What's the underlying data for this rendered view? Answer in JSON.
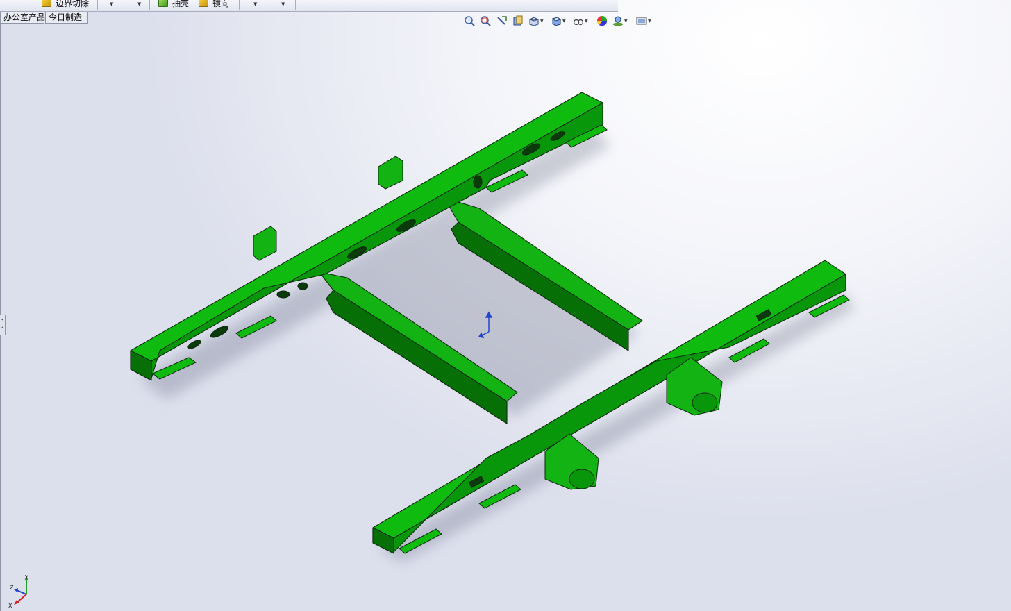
{
  "toolbar": {
    "buttons": [
      {
        "id": "boundary-cut",
        "label": "边界切除",
        "icon": "boundary-cut-icon"
      },
      {
        "id": "shell",
        "label": "抽壳",
        "icon": "shell-icon"
      },
      {
        "id": "mirror",
        "label": "镜向",
        "icon": "mirror-icon"
      }
    ]
  },
  "tabs": [
    {
      "label": "办公室产品"
    },
    {
      "label": "今日制造"
    }
  ],
  "heads_up_toolbar": [
    {
      "icon": "zoom-to-fit-icon"
    },
    {
      "icon": "zoom-to-area-icon"
    },
    {
      "icon": "previous-view-icon"
    },
    {
      "icon": "section-view-icon"
    },
    {
      "icon": "view-orientation-icon"
    },
    {
      "icon": "display-style-icon"
    },
    {
      "icon": "hide-show-items-icon"
    },
    {
      "icon": "edit-appearance-icon"
    },
    {
      "icon": "apply-scene-icon"
    },
    {
      "icon": "view-settings-icon"
    }
  ],
  "model": {
    "color": "#0aa30a",
    "edge_color": "#0b2a0b",
    "shade_color": "#067006"
  },
  "triad": {
    "x_label": "X",
    "y_label": "Y",
    "z_label": "Z"
  }
}
